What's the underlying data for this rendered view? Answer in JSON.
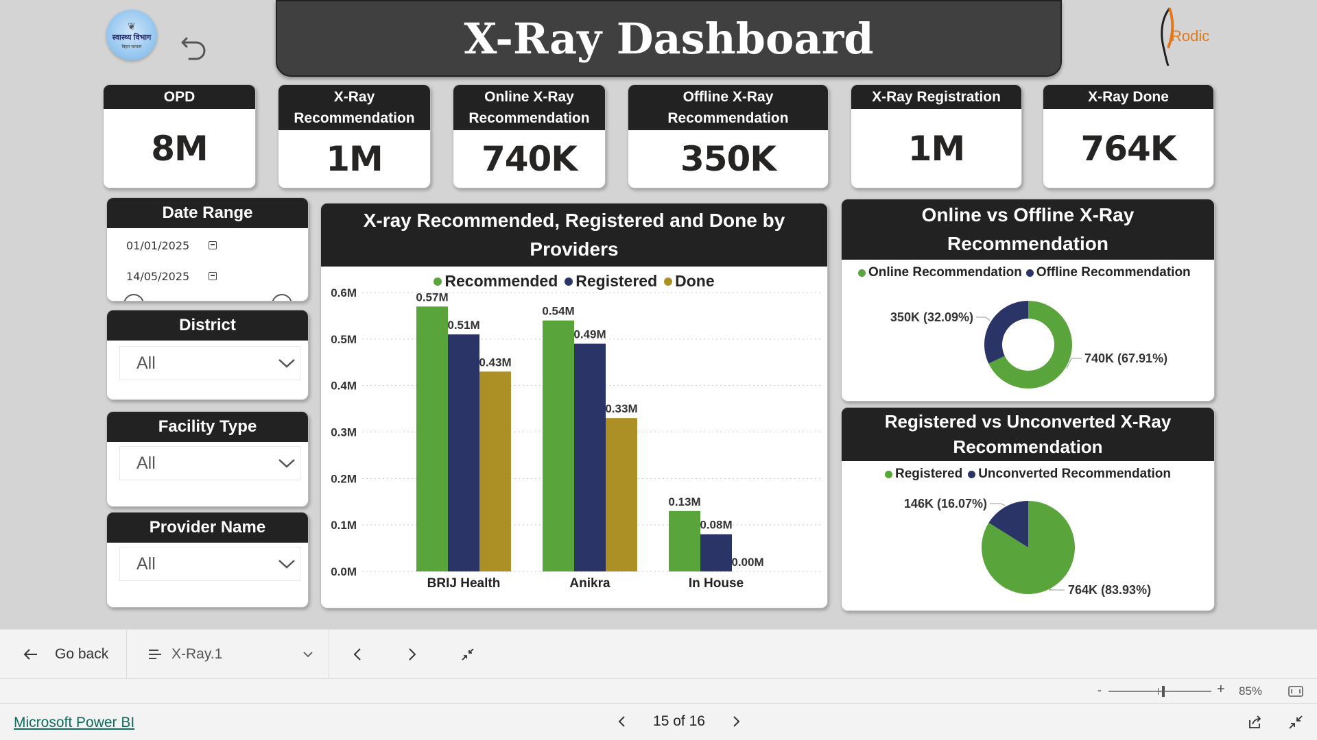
{
  "header": {
    "title": "X-Ray Dashboard",
    "left_logo": {
      "line1": "स्वास्थ्य विभाग",
      "line2": "बिहार सरकार"
    },
    "right_logo": {
      "text": "Rodic"
    }
  },
  "kpis": [
    {
      "label": "OPD",
      "value": "8M"
    },
    {
      "label": "X-Ray Recommendation",
      "value": "1M"
    },
    {
      "label": "Online X-Ray Recommendation",
      "value": "740K"
    },
    {
      "label": "Offline X-Ray Recommendation",
      "value": "350K"
    },
    {
      "label": "X-Ray Registration",
      "value": "1M"
    },
    {
      "label": "X-Ray Done",
      "value": "764K"
    }
  ],
  "filters": {
    "date_range": {
      "label": "Date Range",
      "from": "01/01/2025",
      "to": "14/05/2025"
    },
    "district": {
      "label": "District",
      "value": "All"
    },
    "facility_type": {
      "label": "Facility Type",
      "value": "All"
    },
    "provider_name": {
      "label": "Provider Name",
      "value": "All"
    }
  },
  "colors": {
    "green": "#5aa43c",
    "navy": "#2b3467",
    "gold": "#ad9025"
  },
  "chart_data": [
    {
      "type": "bar",
      "title": "X-ray Recommended, Registered and Done by Providers",
      "categories": [
        "BRIJ Health",
        "Anikra",
        "In House"
      ],
      "series": [
        {
          "name": "Recommended",
          "values": [
            0.57,
            0.54,
            0.13
          ],
          "labels": [
            "0.57M",
            "0.54M",
            "0.13M"
          ],
          "color": "#5aa43c"
        },
        {
          "name": "Registered",
          "values": [
            0.51,
            0.49,
            0.08
          ],
          "labels": [
            "0.51M",
            "0.49M",
            "0.08M"
          ],
          "color": "#2b3467"
        },
        {
          "name": "Done",
          "values": [
            0.43,
            0.33,
            0.0
          ],
          "labels": [
            "0.43M",
            "0.33M",
            "0.00M"
          ],
          "color": "#ad9025"
        }
      ],
      "ylim": [
        0,
        0.6
      ],
      "yticks": [
        "0.0M",
        "0.1M",
        "0.2M",
        "0.3M",
        "0.4M",
        "0.5M",
        "0.6M"
      ],
      "legend": "top-center",
      "grid": true
    },
    {
      "type": "pie",
      "title": "Online vs Offline X-Ray Recommendation",
      "donut": true,
      "slices": [
        {
          "name": "Online Recommendation",
          "value": 67.91,
          "label": "740K (67.91%)",
          "color": "#5aa43c"
        },
        {
          "name": "Offline Recommendation",
          "value": 32.09,
          "label": "350K (32.09%)",
          "color": "#2b3467"
        }
      ],
      "legend": "top-left"
    },
    {
      "type": "pie",
      "title": "Registered vs Unconverted X-Ray Recommendation",
      "donut": false,
      "slices": [
        {
          "name": "Registered",
          "value": 83.93,
          "label": "764K (83.93%)",
          "color": "#5aa43c"
        },
        {
          "name": "Unconverted Recommendation",
          "value": 16.07,
          "label": "146K (16.07%)",
          "color": "#2b3467"
        }
      ],
      "legend": "top-center"
    }
  ],
  "nav": {
    "go_back": "Go back",
    "page_name": "X-Ray.1"
  },
  "zoom": {
    "minus": "-",
    "plus": "+",
    "level": "85%",
    "value": 85
  },
  "footer": {
    "link": "Microsoft Power BI",
    "page_indicator": "15 of 16"
  }
}
